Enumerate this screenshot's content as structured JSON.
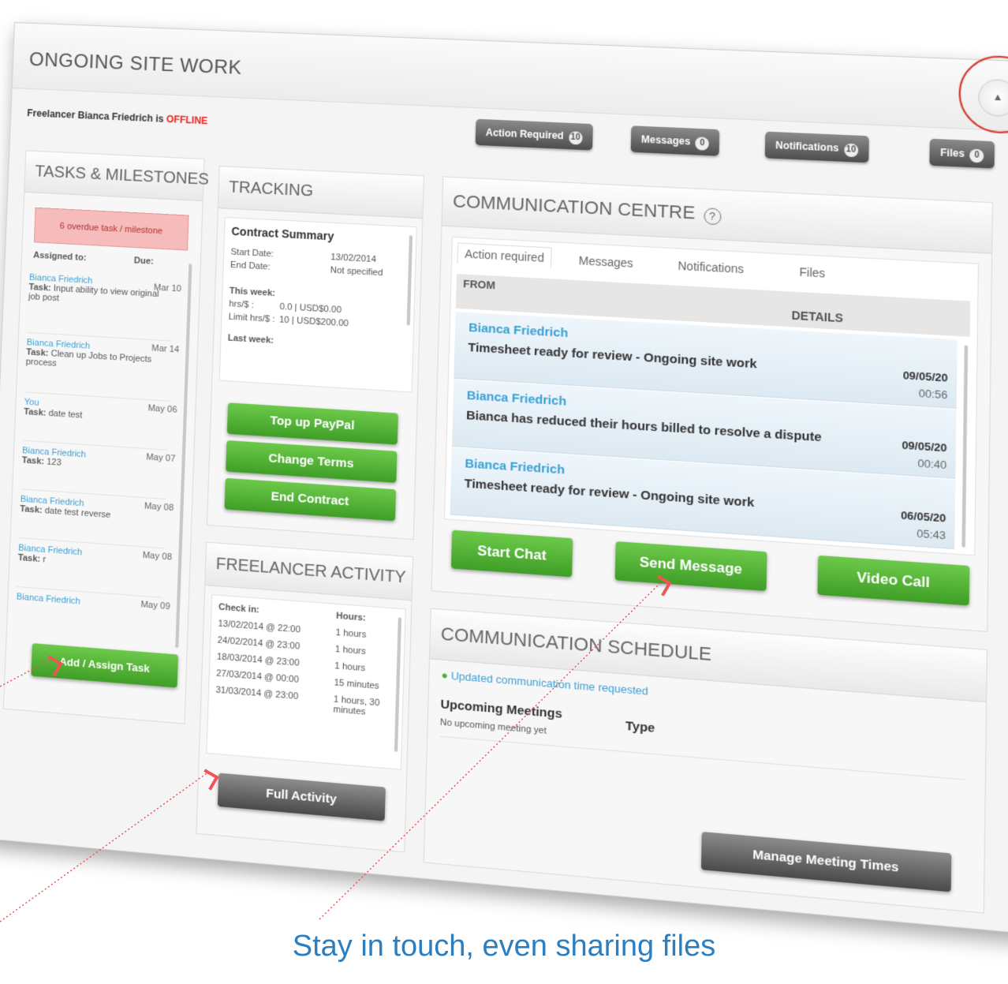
{
  "page": {
    "title": "ONGOING SITE WORK",
    "status_prefix": "Freelancer Bianca Friedrich is ",
    "status_value": "OFFLINE",
    "status_color": "#e22222"
  },
  "header_buttons": [
    {
      "label": "Action Required",
      "count": "10"
    },
    {
      "label": "Messages",
      "count": "0"
    },
    {
      "label": "Notifications",
      "count": "10"
    },
    {
      "label": "Files",
      "count": "0"
    }
  ],
  "tasks": {
    "title": "TASKS & MILESTONES",
    "alert": "6 overdue task / milestone",
    "assigned_label": "Assigned to:",
    "due_label": "Due:",
    "items": [
      {
        "assignee": "Bianca Friedrich",
        "task_label": "Task:",
        "task": "Input ability to view original job post",
        "due": "Mar 10"
      },
      {
        "assignee": "Bianca Friedrich",
        "task_label": "Task:",
        "task": "Clean up Jobs to Projects process",
        "due": "Mar 14"
      },
      {
        "assignee": "You",
        "task_label": "Task:",
        "task": "date test",
        "due": "May 06"
      },
      {
        "assignee": "Bianca Friedrich",
        "task_label": "Task:",
        "task": "123",
        "due": "May 07"
      },
      {
        "assignee": "Bianca Friedrich",
        "task_label": "Task:",
        "task": "date test reverse",
        "due": "May 08"
      },
      {
        "assignee": "Bianca Friedrich",
        "task_label": "Task:",
        "task": "r",
        "due": "May 08"
      },
      {
        "assignee": "Bianca Friedrich",
        "task_label": "",
        "task": "",
        "due": "May 09"
      }
    ],
    "add_button": "Add / Assign Task"
  },
  "tracking": {
    "title": "TRACKING",
    "summary_title": "Contract Summary",
    "start_label": "Start Date:",
    "start_value": "13/02/2014",
    "end_label": "End Date:",
    "end_value": "Not specified",
    "week_label": "This week:",
    "hrs_label": "hrs/$ :",
    "hrs_value": "0.0  |  USD$0.00",
    "limit_label": "Limit hrs/$ :",
    "limit_value": "10  |  USD$200.00",
    "last_week_label": "Last week:",
    "buttons": [
      "Top up PayPal",
      "Change Terms",
      "End Contract"
    ]
  },
  "activity": {
    "title": "FREELANCER ACTIVITY",
    "checkin_label": "Check in:",
    "hours_label": "Hours:",
    "rows": [
      {
        "checkin": "13/02/2014 @ 22:00",
        "hours": "1 hours"
      },
      {
        "checkin": "24/02/2014 @ 23:00",
        "hours": "1 hours"
      },
      {
        "checkin": "18/03/2014 @ 23:00",
        "hours": "1 hours"
      },
      {
        "checkin": "27/03/2014 @ 00:00",
        "hours": "15 minutes"
      },
      {
        "checkin": "31/03/2014 @ 23:00",
        "hours": "1 hours, 30 minutes"
      }
    ],
    "full_button": "Full Activity"
  },
  "communication": {
    "title": "COMMUNICATION CENTRE",
    "help_icon": "question-circle-icon",
    "tabs": [
      "Action required",
      "Messages",
      "Notifications",
      "Files"
    ],
    "col_from": "FROM",
    "col_details": "DETAILS",
    "messages": [
      {
        "from": "Bianca Friedrich",
        "subject": "Timesheet ready for review - Ongoing site work",
        "date": "09/05/20",
        "time": "00:56"
      },
      {
        "from": "Bianca Friedrich",
        "subject": "Bianca has reduced their hours billed to resolve a dispute",
        "date": "09/05/20",
        "time": "00:40"
      },
      {
        "from": "Bianca Friedrich",
        "subject": "Timesheet ready for review - Ongoing site work",
        "date": "06/05/20",
        "time": "05:43"
      }
    ],
    "buttons": [
      "Start Chat",
      "Send Message",
      "Video Call"
    ]
  },
  "schedule": {
    "title": "COMMUNICATION SCHEDULE",
    "notice": "Updated communication time requested",
    "upcoming_label": "Upcoming Meetings",
    "type_label": "Type",
    "empty_text": "No upcoming meeting yet",
    "manage_button": "Manage Meeting Times"
  },
  "caption": "Stay in touch, even sharing files",
  "colors": {
    "accent_green": "#4caf2f",
    "link_blue": "#3aa0d4",
    "caption_blue": "#2b7fc1",
    "alert_red": "#d73a2f"
  }
}
